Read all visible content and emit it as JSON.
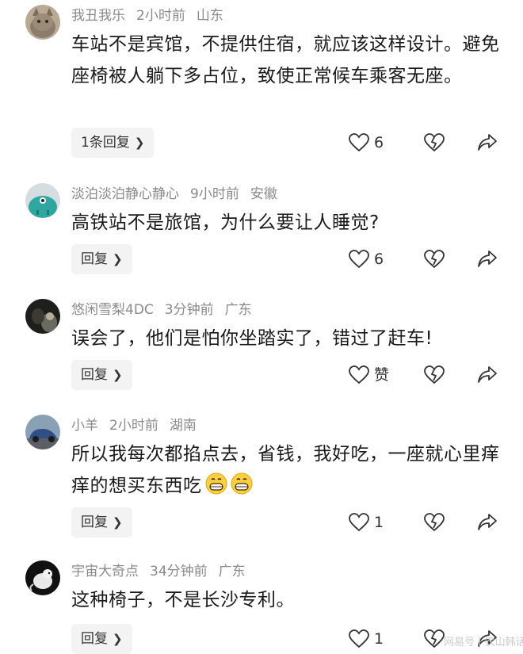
{
  "comments": [
    {
      "username": "我丑我乐",
      "time": "2小时前",
      "location": "山东",
      "text": "车站不是宾馆，不提供住宿，就应该这样设计。避免座椅被人躺下多占位，致使正常候车乘客无座。",
      "reply_label": "1条回复",
      "likes": "6",
      "avatar": "cat-avatar"
    },
    {
      "username": "淡泊淡泊静心静心",
      "time": "9小时前",
      "location": "安徽",
      "text": "高铁站不是旅馆，为什么要让人睡觉?",
      "reply_label": "回复",
      "likes": "6",
      "avatar": "teal-blob-avatar"
    },
    {
      "username": "悠闲雪梨4DC",
      "time": "3分钟前",
      "location": "广东",
      "text": "误会了，他们是怕你坐踏实了，错过了赶车!",
      "reply_label": "回复",
      "likes": "赞",
      "avatar": "dark-photo-avatar"
    },
    {
      "username": "小羊",
      "time": "2小时前",
      "location": "湖南",
      "text": "所以我每次都掐点去，省钱，我好吃，一座就心里痒痒的想买东西吃",
      "reply_label": "回复",
      "likes": "1",
      "avatar": "car-avatar",
      "emoji": [
        "grinning-face-emoji",
        "grinning-face-emoji"
      ]
    },
    {
      "username": "宇宙大奇点",
      "time": "34分钟前",
      "location": "广东",
      "text": "这种椅子，不是长沙专利。",
      "reply_label": "回复",
      "likes": "1",
      "avatar": "white-animal-avatar"
    }
  ],
  "icons": {
    "like": "heart-icon",
    "dislike": "broken-heart-icon",
    "share": "share-arrow-icon",
    "chevron": "chevron-right-icon"
  },
  "watermark": "网易号 | 农山韩话",
  "colors": {
    "meta": "#8a8a8a",
    "text": "#1a1a1a",
    "reply_bg": "#f3f3f3"
  }
}
